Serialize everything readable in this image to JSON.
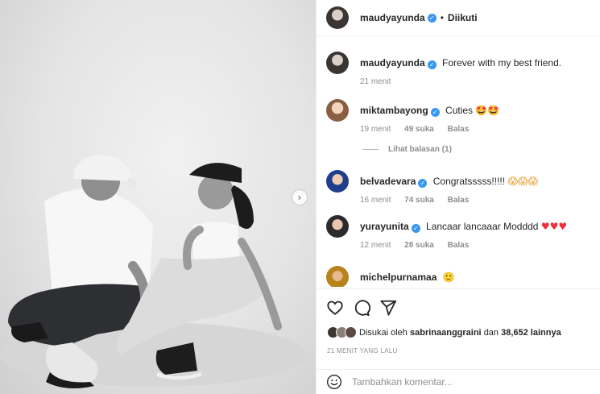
{
  "post": {
    "author": "maudyayunda",
    "follow_status": "Diikuti",
    "separator": "•",
    "caption": "Forever with my best friend.",
    "caption_time": "21 menit"
  },
  "icons": {
    "verified": "verified-badge-icon",
    "next": "chevron-right-icon",
    "like": "heart-outline-icon",
    "comment": "speech-bubble-icon",
    "share": "paper-plane-icon",
    "emoji": "smiley-face-icon"
  },
  "comments": [
    {
      "user": "miktambayong",
      "text": "Cuties",
      "emoji": "🤩🤩",
      "time": "19 menit",
      "likes": "49 suka",
      "reply": "Balas"
    },
    {
      "user": "belvadevara",
      "text": "Congratsssss!!!!!",
      "emoji": "😱😱😱",
      "time": "16 menit",
      "likes": "74 suka",
      "reply": "Balas"
    },
    {
      "user": "yurayunita",
      "text": "Lancaar lancaaar Modddd",
      "emoji": "♥♥♥",
      "time": "12 menit",
      "likes": "28 suka",
      "reply": "Balas"
    },
    {
      "user": "michelpurnamaa",
      "text": "",
      "emoji": "🙂"
    }
  ],
  "view_replies": "Lihat balasan (1)",
  "likes": {
    "prefix": "Disukai oleh",
    "user": "sabrinaanggraini",
    "middle": "dan",
    "count": "38,652 lainnya"
  },
  "time_ago": "21 MENIT YANG LALU",
  "add_comment": {
    "placeholder": "Tambahkan komentar..."
  },
  "colors": {
    "verified": "#3897f0",
    "muted": "#8e8e8e",
    "border": "#efefef"
  }
}
